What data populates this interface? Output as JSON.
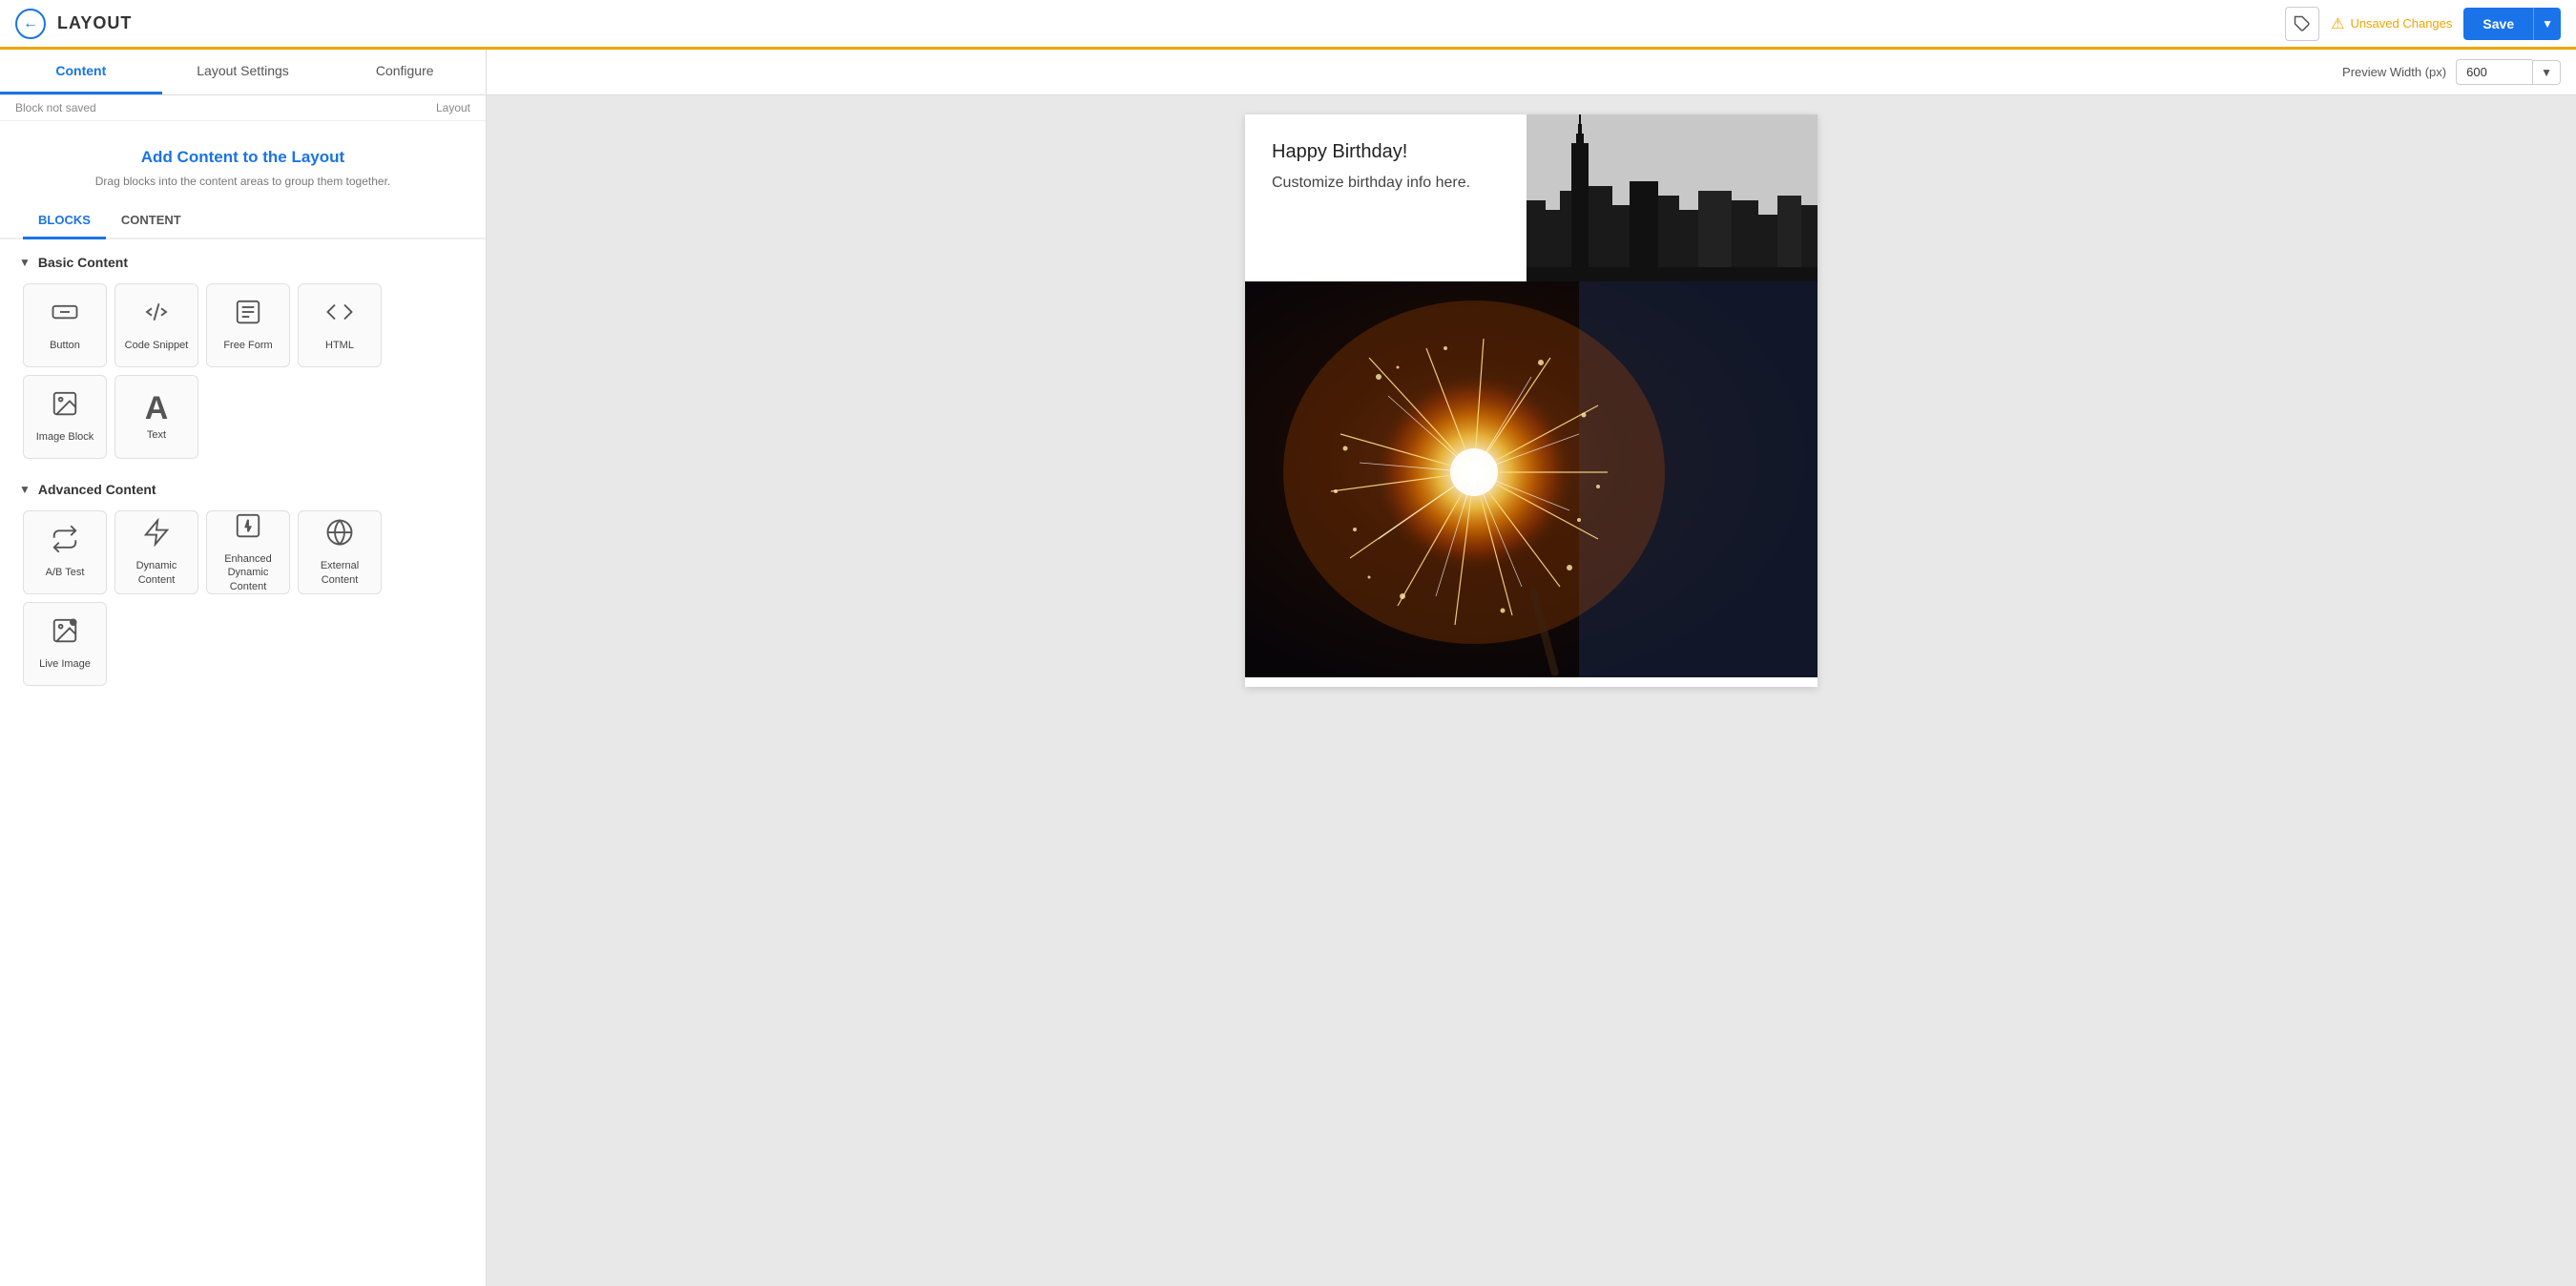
{
  "topBar": {
    "title": "LAYOUT",
    "unsavedLabel": "Unsaved Changes",
    "saveLabel": "Save",
    "tagIconTitle": "tag"
  },
  "tabs": [
    {
      "id": "content",
      "label": "Content",
      "active": true
    },
    {
      "id": "layout-settings",
      "label": "Layout Settings",
      "active": false
    },
    {
      "id": "configure",
      "label": "Configure",
      "active": false
    }
  ],
  "breadcrumb": "Layout",
  "blockNotSaved": "Block not saved",
  "addContentHeader": {
    "title": "Add Content to the Layout",
    "subtitle": "Drag blocks into the content areas to group them together."
  },
  "subTabs": [
    {
      "id": "blocks",
      "label": "BLOCKS",
      "active": true
    },
    {
      "id": "content-tab",
      "label": "CONTENT",
      "active": false
    }
  ],
  "basicContent": {
    "label": "Basic Content",
    "blocks": [
      {
        "id": "button",
        "icon": "⊡",
        "label": "Button"
      },
      {
        "id": "code-snippet",
        "icon": "{}",
        "label": "Code Snippet"
      },
      {
        "id": "free-form",
        "icon": "≡",
        "label": "Free Form"
      },
      {
        "id": "html",
        "icon": "</>",
        "label": "HTML"
      },
      {
        "id": "image-block",
        "icon": "🖼",
        "label": "Image Block"
      },
      {
        "id": "text",
        "icon": "A",
        "label": "Text"
      }
    ]
  },
  "advancedContent": {
    "label": "Advanced Content",
    "blocks": [
      {
        "id": "ab-test",
        "icon": "⇄",
        "label": "A/B Test"
      },
      {
        "id": "dynamic-content",
        "icon": "⚡",
        "label": "Dynamic Content"
      },
      {
        "id": "enhanced-dynamic",
        "icon": "⚡+",
        "label": "Enhanced Dynamic Content"
      },
      {
        "id": "external-content",
        "icon": "🌐",
        "label": "External Content"
      },
      {
        "id": "live-image",
        "icon": "🖼+",
        "label": "Live Image"
      }
    ]
  },
  "preview": {
    "widthLabel": "Preview Width (px)",
    "widthValue": "600",
    "content": {
      "birthdayText": "Happy Birthday!",
      "subtitleText": "Customize birthday info here."
    }
  }
}
